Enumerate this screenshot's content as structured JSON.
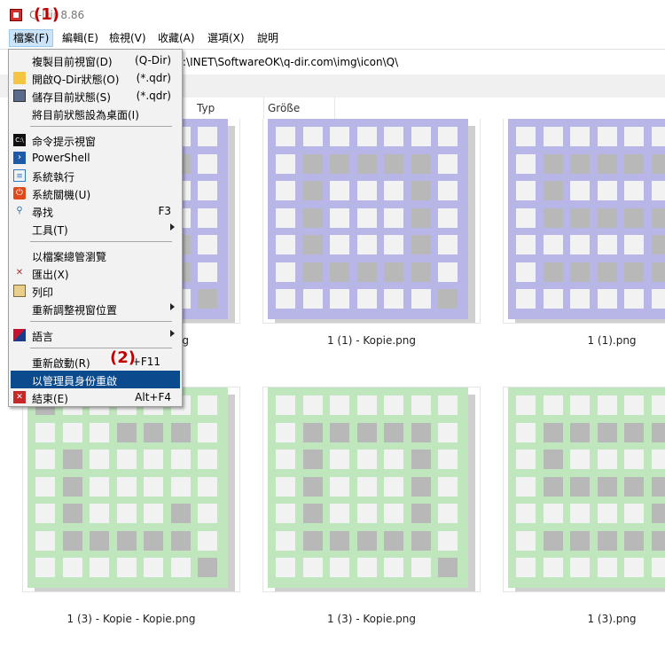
{
  "window": {
    "title": "Q-Dir 8.86",
    "callout_1": "(1)",
    "callout_2": "(2)"
  },
  "menubar": [
    {
      "label": "檔案(F)"
    },
    {
      "label": "編輯(E)"
    },
    {
      "label": "檢視(V)"
    },
    {
      "label": "收藏(A)"
    },
    {
      "label": "選項(X)"
    },
    {
      "label": "說明"
    }
  ],
  "address": {
    "path": ":\\INET\\SoftwareOK\\q-dir.com\\img\\icon\\Q\\"
  },
  "columns": [
    {
      "label": "Typ"
    },
    {
      "label": "Größe"
    }
  ],
  "file_menu": [
    {
      "label": "複製目前視窗(D)",
      "shortcut": "(Q-Dir)",
      "icon": "copy-window-icon"
    },
    {
      "label": "開啟Q-Dir狀態(O)",
      "shortcut": "(*.qdr)",
      "icon": "folder-icon"
    },
    {
      "label": "儲存目前狀態(S)",
      "shortcut": "(*.qdr)",
      "icon": "save-icon"
    },
    {
      "label": "將目前狀態設為桌面(I)",
      "shortcut": "",
      "icon": ""
    },
    {
      "label": "命令提示視窗",
      "shortcut": "",
      "icon": "command-prompt-icon"
    },
    {
      "label": "PowerShell",
      "shortcut": "",
      "icon": "powershell-icon"
    },
    {
      "label": "系統執行",
      "shortcut": "",
      "icon": "run-icon"
    },
    {
      "label": "系統關機(U)",
      "shortcut": "",
      "icon": "shutdown-icon"
    },
    {
      "label": "尋找",
      "shortcut": "F3",
      "icon": "search-icon"
    },
    {
      "label": "工具(T)",
      "shortcut": "",
      "icon": "",
      "submenu": true
    },
    {
      "label": "以檔案總管瀏覽",
      "shortcut": "",
      "icon": ""
    },
    {
      "label": "匯出(X)",
      "shortcut": "",
      "icon": "export-icon"
    },
    {
      "label": "列印",
      "shortcut": "",
      "icon": "print-icon"
    },
    {
      "label": "重新調整視窗位置",
      "shortcut": "",
      "icon": "",
      "submenu": true
    },
    {
      "label": "語言",
      "shortcut": "",
      "icon": "language-flag-icon",
      "submenu": true
    },
    {
      "label": "重新啟動(R)",
      "shortcut": "+F11",
      "icon": ""
    },
    {
      "label": "以管理員身份重啟",
      "shortcut": "",
      "icon": "",
      "highlighted": true
    },
    {
      "label": "結束(E)",
      "shortcut": "Alt+F4",
      "icon": "exit-icon"
    }
  ],
  "files": [
    {
      "name": "",
      "tint": "#b7b6e6"
    },
    {
      "name": "1 (1) - Kopie.png",
      "tint": "#b7b6e6"
    },
    {
      "name": "1 (1).png",
      "tint": "#b7b6e6"
    },
    {
      "name": "1 (3) - Kopie - Kopie.png",
      "tint": "#bfe6bd"
    },
    {
      "name": "1 (3) - Kopie.png",
      "tint": "#bfe6bd"
    },
    {
      "name": "1 (3).png",
      "tint": "#bfe6bd"
    }
  ],
  "first_file_name_fragment": "g",
  "colors": {
    "menu_highlight": "#0b4a8c",
    "callout": "#c00000",
    "purple_tint": "#b7b6e6",
    "green_tint": "#bfe6bd"
  }
}
